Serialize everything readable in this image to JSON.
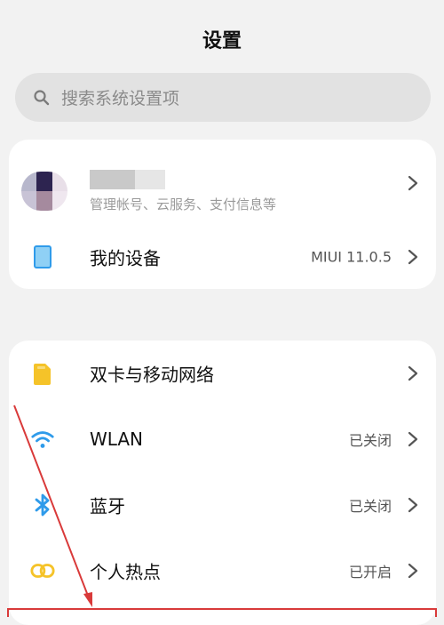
{
  "header": {
    "title": "设置"
  },
  "search": {
    "placeholder": "搜索系统设置项"
  },
  "account": {
    "subtitle": "管理帐号、云服务、支付信息等"
  },
  "device": {
    "label": "我的设备",
    "value": "MIUI 11.0.5"
  },
  "network": {
    "items": [
      {
        "label": "双卡与移动网络",
        "value": "",
        "icon": "sim-card-icon"
      },
      {
        "label": "WLAN",
        "value": "已关闭",
        "icon": "wifi-icon"
      },
      {
        "label": "蓝牙",
        "value": "已关闭",
        "icon": "bluetooth-icon"
      },
      {
        "label": "个人热点",
        "value": "已开启",
        "icon": "hotspot-icon"
      }
    ]
  },
  "colors": {
    "background": "#f2f2f2",
    "card": "#ffffff",
    "annotation": "#d93a3a",
    "sim_icon": "#f5c329",
    "wifi_icon": "#2f9bea",
    "bluetooth_icon": "#2f9bea",
    "hotspot_icon": "#f5c329",
    "device_icon": "#2f9bea"
  }
}
